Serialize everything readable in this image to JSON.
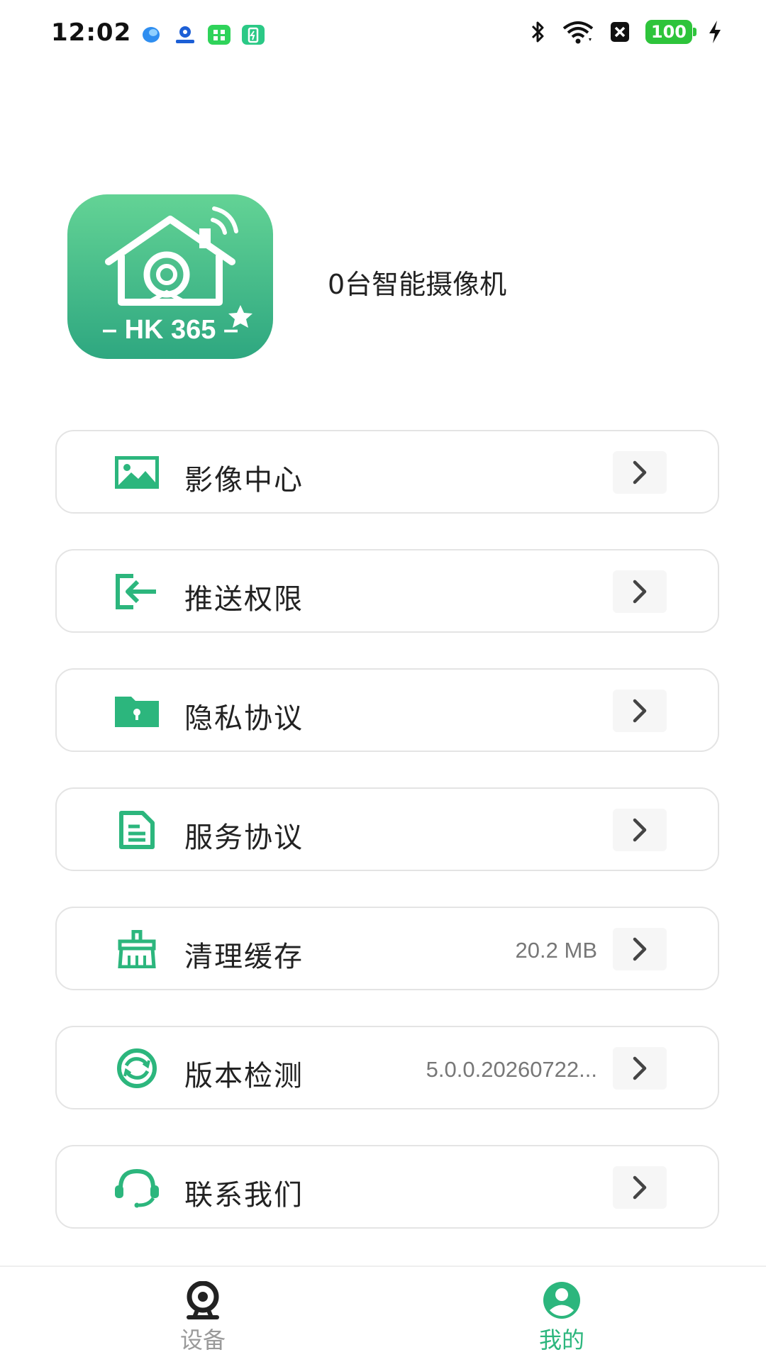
{
  "status_bar": {
    "time": "12:02",
    "battery": "100",
    "notification_icons": [
      "app-notification-icon",
      "location-notification-icon",
      "market-notification-icon",
      "charge-notification-icon"
    ],
    "system_icons": [
      "bluetooth-icon",
      "wifi-icon",
      "no-sim-icon",
      "battery-icon",
      "charging-icon"
    ]
  },
  "header": {
    "logo_text": "– HK 365 –",
    "camera_count": "0台智能摄像机"
  },
  "menu": [
    {
      "label": "影像中心",
      "value": "",
      "icon": "image-icon"
    },
    {
      "label": "推送权限",
      "value": "",
      "icon": "login-arrow-icon"
    },
    {
      "label": "隐私协议",
      "value": "",
      "icon": "locked-folder-icon"
    },
    {
      "label": "服务协议",
      "value": "",
      "icon": "document-icon"
    },
    {
      "label": "清理缓存",
      "value": "20.2 MB",
      "icon": "broom-icon"
    },
    {
      "label": "版本检测",
      "value": "5.0.0.20260722...",
      "icon": "refresh-icon"
    },
    {
      "label": "联系我们",
      "value": "",
      "icon": "headset-icon"
    }
  ],
  "bottom_nav": {
    "devices_label": "设备",
    "mine_label": "我的"
  },
  "colors": {
    "accent": "#2cb67d",
    "inactive": "#9a9a9a",
    "border": "#e4e4e4",
    "battery": "#2ec43b"
  }
}
